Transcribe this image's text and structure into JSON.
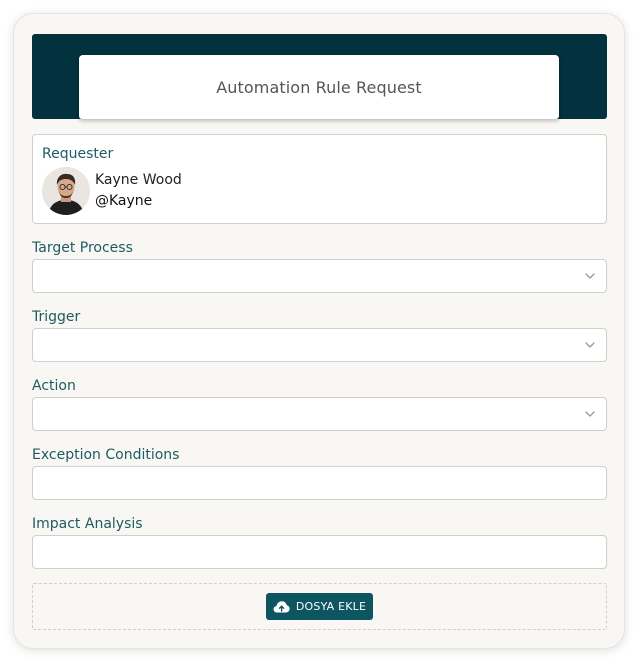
{
  "form": {
    "title": "Automation Rule Request"
  },
  "requester": {
    "label": "Requester",
    "name": "Kayne Wood",
    "handle": "@Kayne"
  },
  "fields": {
    "target_process": {
      "label": "Target Process",
      "value": ""
    },
    "trigger": {
      "label": "Trigger",
      "value": ""
    },
    "action": {
      "label": "Action",
      "value": ""
    },
    "exception_conditions": {
      "label": "Exception Conditions",
      "value": ""
    },
    "impact_analysis": {
      "label": "Impact Analysis",
      "value": ""
    }
  },
  "upload": {
    "button_label": "DOSYA EKLE",
    "icon": "cloud-upload-icon"
  },
  "colors": {
    "header_bg": "#02323d",
    "label_color": "#1f5b62",
    "button_bg": "#0d5560"
  }
}
